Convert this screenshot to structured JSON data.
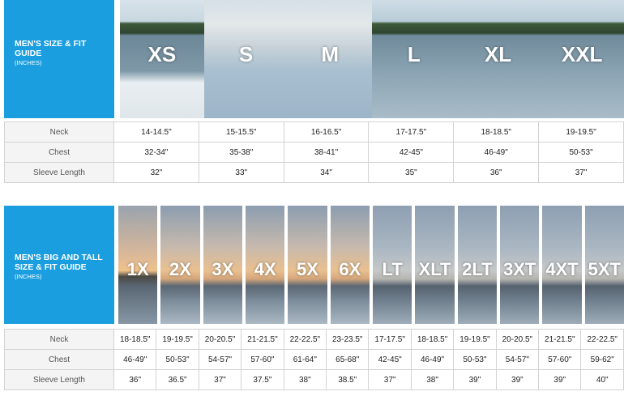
{
  "regular": {
    "title": "MEN'S SIZE & FIT GUIDE",
    "unit": "(INCHES)",
    "sizes": [
      "XS",
      "S",
      "M",
      "L",
      "XL",
      "XXL"
    ],
    "rows": [
      {
        "label": "Neck",
        "values": [
          "14-14.5\"",
          "15-15.5\"",
          "16-16.5\"",
          "17-17.5\"",
          "18-18.5\"",
          "19-19.5\""
        ]
      },
      {
        "label": "Chest",
        "values": [
          "32-34\"",
          "35-38\"",
          "38-41\"",
          "42-45\"",
          "46-49\"",
          "50-53\""
        ]
      },
      {
        "label": "Sleeve Length",
        "values": [
          "32\"",
          "33\"",
          "34\"",
          "35\"",
          "36\"",
          "37\""
        ]
      }
    ]
  },
  "big_tall": {
    "title": "MEN'S BIG AND TALL SIZE & FIT GUIDE",
    "unit": "(INCHES)",
    "sizes": [
      "1X",
      "2X",
      "3X",
      "4X",
      "5X",
      "6X",
      "LT",
      "XLT",
      "2LT",
      "3XT",
      "4XT",
      "5XT"
    ],
    "rows": [
      {
        "label": "Neck",
        "values": [
          "18-18.5\"",
          "19-19.5\"",
          "20-20.5\"",
          "21-21.5\"",
          "22-22.5\"",
          "23-23.5\"",
          "17-17.5\"",
          "18-18.5\"",
          "19-19.5\"",
          "20-20.5\"",
          "21-21.5\"",
          "22-22.5\""
        ]
      },
      {
        "label": "Chest",
        "values": [
          "46-49\"",
          "50-53\"",
          "54-57\"",
          "57-60\"",
          "61-64\"",
          "65-68\"",
          "42-45\"",
          "46-49\"",
          "50-53\"",
          "54-57\"",
          "57-60\"",
          "59-62\""
        ]
      },
      {
        "label": "Sleeve Length",
        "values": [
          "36\"",
          "36.5\"",
          "37\"",
          "37.5\"",
          "38\"",
          "38.5\"",
          "37\"",
          "38\"",
          "39\"",
          "39\"",
          "39\"",
          "40\""
        ]
      }
    ]
  },
  "colors": {
    "brand_blue": "#1a9ee0",
    "grid_line": "#d3d3d3",
    "label_bg": "#f4f4f4"
  }
}
